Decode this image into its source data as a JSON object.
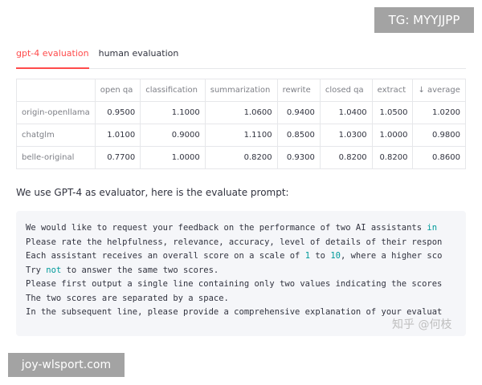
{
  "watermarks": {
    "top": "TG: MYYJJPP",
    "bottom": "joy-wlsport.com",
    "zhihu": "知乎 @何枝"
  },
  "tabs": [
    {
      "label": "gpt-4 evaluation",
      "active": true
    },
    {
      "label": "human evaluation",
      "active": false
    }
  ],
  "table": {
    "columns": [
      "",
      "open qa",
      "classification",
      "summarization",
      "rewrite",
      "closed qa",
      "extract",
      "↓ average"
    ],
    "rows": [
      [
        "origin-openllama",
        "0.9500",
        "1.1000",
        "1.0600",
        "0.9400",
        "1.0400",
        "1.0500",
        "1.0200"
      ],
      [
        "chatglm",
        "1.0100",
        "0.9000",
        "1.1100",
        "0.8500",
        "1.0300",
        "1.0000",
        "0.9800"
      ],
      [
        "belle-original",
        "0.7700",
        "1.0000",
        "0.8200",
        "0.9300",
        "0.8200",
        "0.8200",
        "0.8600"
      ]
    ]
  },
  "intro": "We use GPT-4 as evaluator, here is the evaluate prompt:",
  "prompt": {
    "line1_a": "We would like to request your feedback on the performance of two AI assistants ",
    "line1_kw": "in",
    "line2": "Please rate the helpfulness, relevance, accuracy, level of details of their respon",
    "line3_a": "Each assistant receives an overall score on a scale of ",
    "line3_n1": "1",
    "line3_b": " to ",
    "line3_n2": "10",
    "line3_c": ", where a higher sco",
    "line4_a": "Try ",
    "line4_kw": "not",
    "line4_b": " to answer the same two scores.",
    "line5": "Please first output a single line containing only two values indicating the scores",
    "line6": "The two scores are separated by a space.",
    "line7": "In the subsequent line, please provide a comprehensive explanation of your evaluat"
  },
  "colors": {
    "accent": "#ff4b4b",
    "code_keyword": "#009a9a",
    "code_background": "#f5f6f9"
  }
}
